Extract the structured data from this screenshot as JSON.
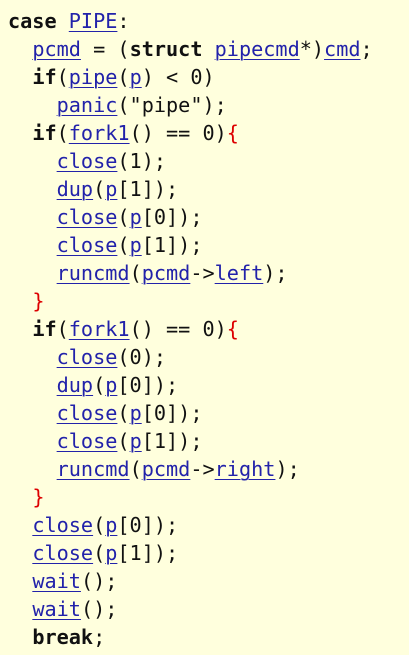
{
  "code": {
    "lines": [
      [
        {
          "t": "case",
          "c": "kw"
        },
        {
          "t": " ",
          "c": "p"
        },
        {
          "t": "PIPE",
          "c": "id"
        },
        {
          "t": ":",
          "c": "p"
        }
      ],
      [
        {
          "t": "  ",
          "c": "p"
        },
        {
          "t": "pcmd",
          "c": "id"
        },
        {
          "t": " = (",
          "c": "p"
        },
        {
          "t": "struct",
          "c": "kw"
        },
        {
          "t": " ",
          "c": "p"
        },
        {
          "t": "pipecmd",
          "c": "id"
        },
        {
          "t": "*)",
          "c": "p"
        },
        {
          "t": "cmd",
          "c": "id"
        },
        {
          "t": ";",
          "c": "p"
        }
      ],
      [
        {
          "t": "  ",
          "c": "p"
        },
        {
          "t": "if",
          "c": "kw"
        },
        {
          "t": "(",
          "c": "p"
        },
        {
          "t": "pipe",
          "c": "id"
        },
        {
          "t": "(",
          "c": "p"
        },
        {
          "t": "p",
          "c": "id"
        },
        {
          "t": ") < 0)",
          "c": "p"
        }
      ],
      [
        {
          "t": "    ",
          "c": "p"
        },
        {
          "t": "panic",
          "c": "id"
        },
        {
          "t": "(\"pipe\");",
          "c": "p"
        }
      ],
      [
        {
          "t": "  ",
          "c": "p"
        },
        {
          "t": "if",
          "c": "kw"
        },
        {
          "t": "(",
          "c": "p"
        },
        {
          "t": "fork1",
          "c": "id"
        },
        {
          "t": "() == 0)",
          "c": "p"
        },
        {
          "t": "{",
          "c": "br"
        }
      ],
      [
        {
          "t": "    ",
          "c": "p"
        },
        {
          "t": "close",
          "c": "id"
        },
        {
          "t": "(1);",
          "c": "p"
        }
      ],
      [
        {
          "t": "    ",
          "c": "p"
        },
        {
          "t": "dup",
          "c": "id"
        },
        {
          "t": "(",
          "c": "p"
        },
        {
          "t": "p",
          "c": "id"
        },
        {
          "t": "[1]);",
          "c": "p"
        }
      ],
      [
        {
          "t": "    ",
          "c": "p"
        },
        {
          "t": "close",
          "c": "id"
        },
        {
          "t": "(",
          "c": "p"
        },
        {
          "t": "p",
          "c": "id"
        },
        {
          "t": "[0]);",
          "c": "p"
        }
      ],
      [
        {
          "t": "    ",
          "c": "p"
        },
        {
          "t": "close",
          "c": "id"
        },
        {
          "t": "(",
          "c": "p"
        },
        {
          "t": "p",
          "c": "id"
        },
        {
          "t": "[1]);",
          "c": "p"
        }
      ],
      [
        {
          "t": "    ",
          "c": "p"
        },
        {
          "t": "runcmd",
          "c": "id"
        },
        {
          "t": "(",
          "c": "p"
        },
        {
          "t": "pcmd",
          "c": "id"
        },
        {
          "t": "->",
          "c": "p"
        },
        {
          "t": "left",
          "c": "id"
        },
        {
          "t": ");",
          "c": "p"
        }
      ],
      [
        {
          "t": "  ",
          "c": "p"
        },
        {
          "t": "}",
          "c": "br"
        }
      ],
      [
        {
          "t": "  ",
          "c": "p"
        },
        {
          "t": "if",
          "c": "kw"
        },
        {
          "t": "(",
          "c": "p"
        },
        {
          "t": "fork1",
          "c": "id"
        },
        {
          "t": "() == 0)",
          "c": "p"
        },
        {
          "t": "{",
          "c": "br"
        }
      ],
      [
        {
          "t": "    ",
          "c": "p"
        },
        {
          "t": "close",
          "c": "id"
        },
        {
          "t": "(0);",
          "c": "p"
        }
      ],
      [
        {
          "t": "    ",
          "c": "p"
        },
        {
          "t": "dup",
          "c": "id"
        },
        {
          "t": "(",
          "c": "p"
        },
        {
          "t": "p",
          "c": "id"
        },
        {
          "t": "[0]);",
          "c": "p"
        }
      ],
      [
        {
          "t": "    ",
          "c": "p"
        },
        {
          "t": "close",
          "c": "id"
        },
        {
          "t": "(",
          "c": "p"
        },
        {
          "t": "p",
          "c": "id"
        },
        {
          "t": "[0]);",
          "c": "p"
        }
      ],
      [
        {
          "t": "    ",
          "c": "p"
        },
        {
          "t": "close",
          "c": "id"
        },
        {
          "t": "(",
          "c": "p"
        },
        {
          "t": "p",
          "c": "id"
        },
        {
          "t": "[1]);",
          "c": "p"
        }
      ],
      [
        {
          "t": "    ",
          "c": "p"
        },
        {
          "t": "runcmd",
          "c": "id"
        },
        {
          "t": "(",
          "c": "p"
        },
        {
          "t": "pcmd",
          "c": "id"
        },
        {
          "t": "->",
          "c": "p"
        },
        {
          "t": "right",
          "c": "id"
        },
        {
          "t": ");",
          "c": "p"
        }
      ],
      [
        {
          "t": "  ",
          "c": "p"
        },
        {
          "t": "}",
          "c": "br"
        }
      ],
      [
        {
          "t": "  ",
          "c": "p"
        },
        {
          "t": "close",
          "c": "id"
        },
        {
          "t": "(",
          "c": "p"
        },
        {
          "t": "p",
          "c": "id"
        },
        {
          "t": "[0]);",
          "c": "p"
        }
      ],
      [
        {
          "t": "  ",
          "c": "p"
        },
        {
          "t": "close",
          "c": "id"
        },
        {
          "t": "(",
          "c": "p"
        },
        {
          "t": "p",
          "c": "id"
        },
        {
          "t": "[1]);",
          "c": "p"
        }
      ],
      [
        {
          "t": "  ",
          "c": "p"
        },
        {
          "t": "wait",
          "c": "id"
        },
        {
          "t": "();",
          "c": "p"
        }
      ],
      [
        {
          "t": "  ",
          "c": "p"
        },
        {
          "t": "wait",
          "c": "id"
        },
        {
          "t": "();",
          "c": "p"
        }
      ],
      [
        {
          "t": "  ",
          "c": "p"
        },
        {
          "t": "break",
          "c": "kw"
        },
        {
          "t": ";",
          "c": "p"
        }
      ]
    ]
  },
  "colors": {
    "background": "#ffffdd",
    "identifier": "#2222aa",
    "brace": "#dd0000",
    "text": "#1a1a1a"
  }
}
